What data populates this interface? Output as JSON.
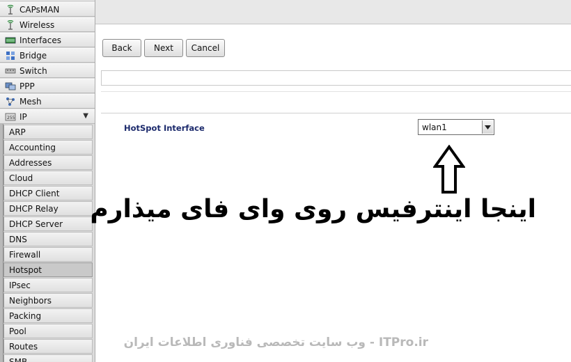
{
  "sidebar": {
    "items": [
      {
        "label": "CAPsMAN",
        "icon": "antenna-icon"
      },
      {
        "label": "Wireless",
        "icon": "antenna-icon"
      },
      {
        "label": "Interfaces",
        "icon": "interface-card-icon"
      },
      {
        "label": "Bridge",
        "icon": "bridge-icon"
      },
      {
        "label": "Switch",
        "icon": "switch-icon"
      },
      {
        "label": "PPP",
        "icon": "ppp-icon"
      },
      {
        "label": "Mesh",
        "icon": "mesh-icon"
      },
      {
        "label": "IP",
        "icon": "ip-icon",
        "expanded": true
      }
    ],
    "ip_submenu": [
      "ARP",
      "Accounting",
      "Addresses",
      "Cloud",
      "DHCP Client",
      "DHCP Relay",
      "DHCP Server",
      "DNS",
      "Firewall",
      "Hotspot",
      "IPsec",
      "Neighbors",
      "Packing",
      "Pool",
      "Routes",
      "SMB"
    ],
    "active_submenu": "Hotspot"
  },
  "toolbar": {
    "back_label": "Back",
    "next_label": "Next",
    "cancel_label": "Cancel"
  },
  "form": {
    "hotspot_interface_label": "HotSpot Interface",
    "hotspot_interface_value": "wlan1"
  },
  "annotation": {
    "text": "اینجا اینترفیس روی وای فای میذارم",
    "arrow_icon": "up-arrow-icon"
  },
  "watermark": {
    "text": "ITPro.ir - وب سایت تخصصی فناوری اطلاعات ایران"
  },
  "colors": {
    "label_blue": "#1c2a6c",
    "watermark_gray": "#b9b9b9"
  }
}
